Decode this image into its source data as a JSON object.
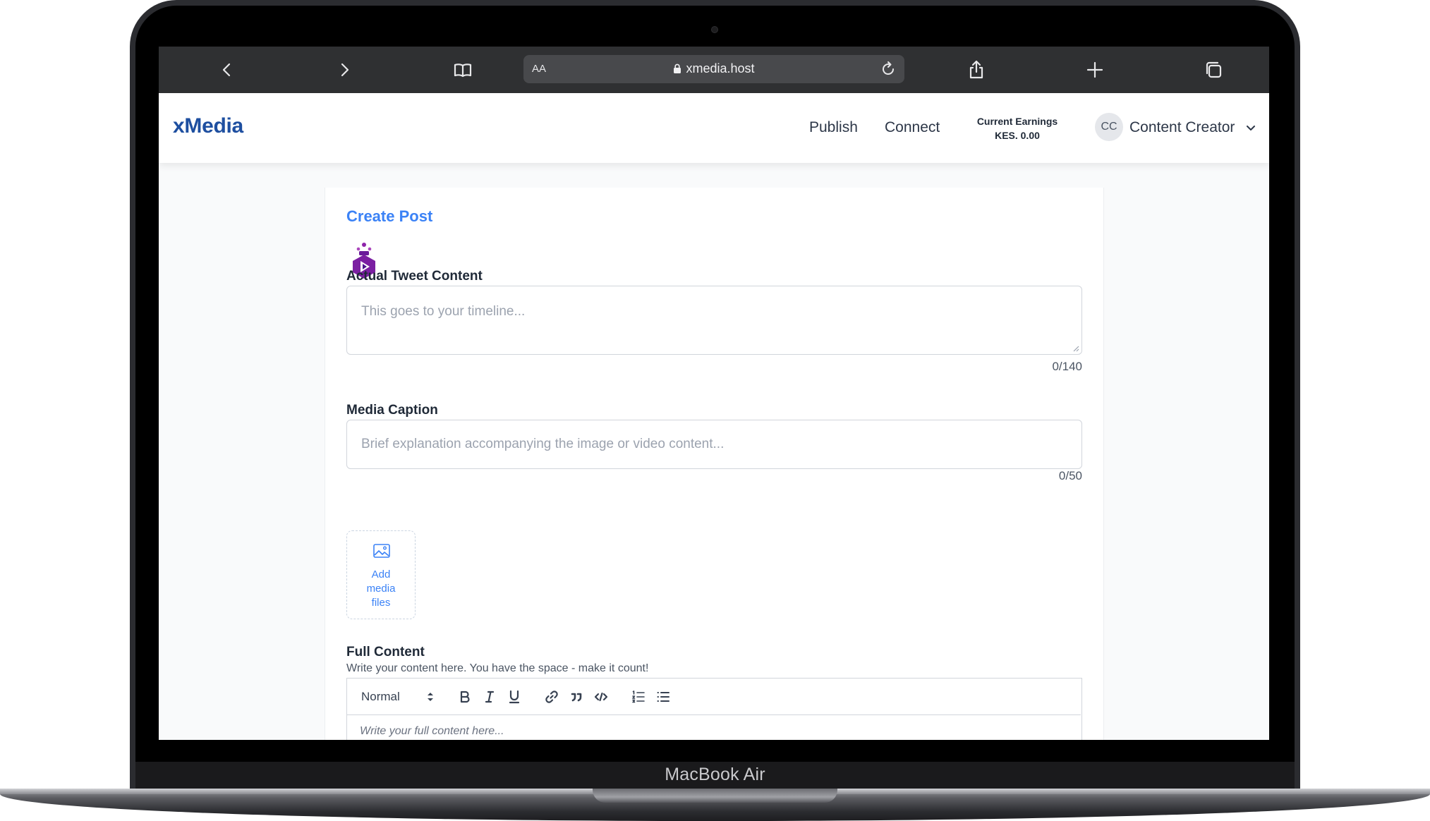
{
  "device": {
    "label": "MacBook Air"
  },
  "browser": {
    "aa_label": "AA",
    "url": "xmedia.host"
  },
  "header": {
    "brand": "xMedia",
    "nav": {
      "publish": "Publish",
      "connect": "Connect"
    },
    "earnings": {
      "label": "Current Earnings",
      "value": "KES. 0.00"
    },
    "user": {
      "initials": "CC",
      "name": "Content Creator"
    }
  },
  "form": {
    "title": "Create Post",
    "tweet": {
      "label": "Actual Tweet Content",
      "placeholder": "This goes to your timeline...",
      "counter": "0/140"
    },
    "caption": {
      "label": "Media Caption",
      "placeholder": "Brief explanation accompanying the image or video content...",
      "counter": "0/50"
    },
    "media": {
      "line1": "Add",
      "line2": "media",
      "line3": "files"
    },
    "full_content": {
      "label": "Full Content",
      "help": "Write your content here. You have the space - make it count!",
      "format_value": "Normal",
      "placeholder": "Write your full content here..."
    }
  },
  "colors": {
    "brand": "#1e4fa0",
    "accent": "#3b82f6",
    "logo": "#7b1fa2"
  }
}
